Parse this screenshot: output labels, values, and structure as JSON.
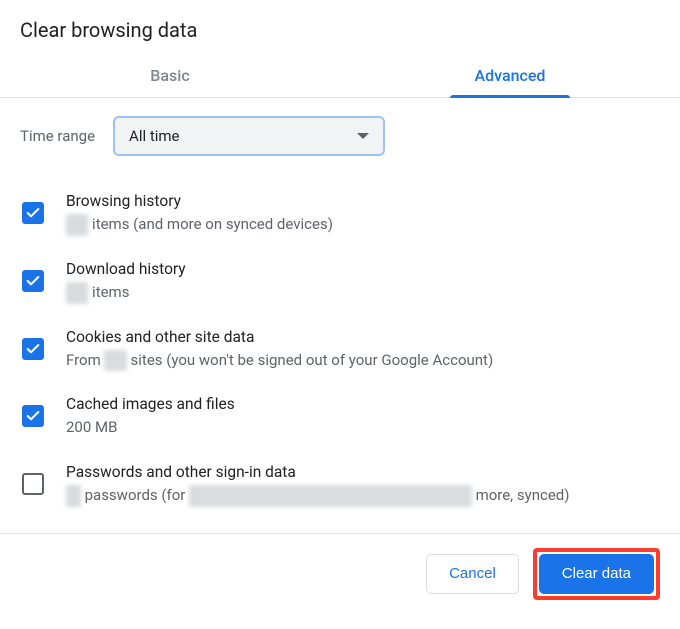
{
  "dialog": {
    "title": "Clear browsing data",
    "tabs": {
      "basic": "Basic",
      "advanced": "Advanced",
      "active": "advanced"
    },
    "timeRange": {
      "label": "Time range",
      "value": "All time"
    },
    "options": [
      {
        "id": "browsing-history",
        "checked": true,
        "title": "Browsing history",
        "desc_prefix_hidden": "xxx",
        "desc_middle": " items (and more on synced devices)",
        "desc_hidden2": "",
        "desc_suffix": ""
      },
      {
        "id": "download-history",
        "checked": true,
        "title": "Download history",
        "desc_prefix_hidden": "xxx",
        "desc_middle": " items",
        "desc_hidden2": "",
        "desc_suffix": ""
      },
      {
        "id": "cookies",
        "checked": true,
        "title": "Cookies and other site data",
        "desc_prefix": "From ",
        "desc_hidden": "xxx",
        "desc_suffix": " sites (you won't be signed out of your Google Account)"
      },
      {
        "id": "cache",
        "checked": true,
        "title": "Cached images and files",
        "desc_plain": "200 MB"
      },
      {
        "id": "passwords",
        "checked": false,
        "title": "Passwords and other sign-in data",
        "desc_hidden1": "xx",
        "desc_mid1": " passwords (for ",
        "desc_hidden2": "xxxxxxxxxxxxxxxxxxxxxxxxxxxxxxxxxxxxxx",
        "desc_mid2": " more, synced)"
      }
    ],
    "buttons": {
      "cancel": "Cancel",
      "clear": "Clear data"
    }
  }
}
